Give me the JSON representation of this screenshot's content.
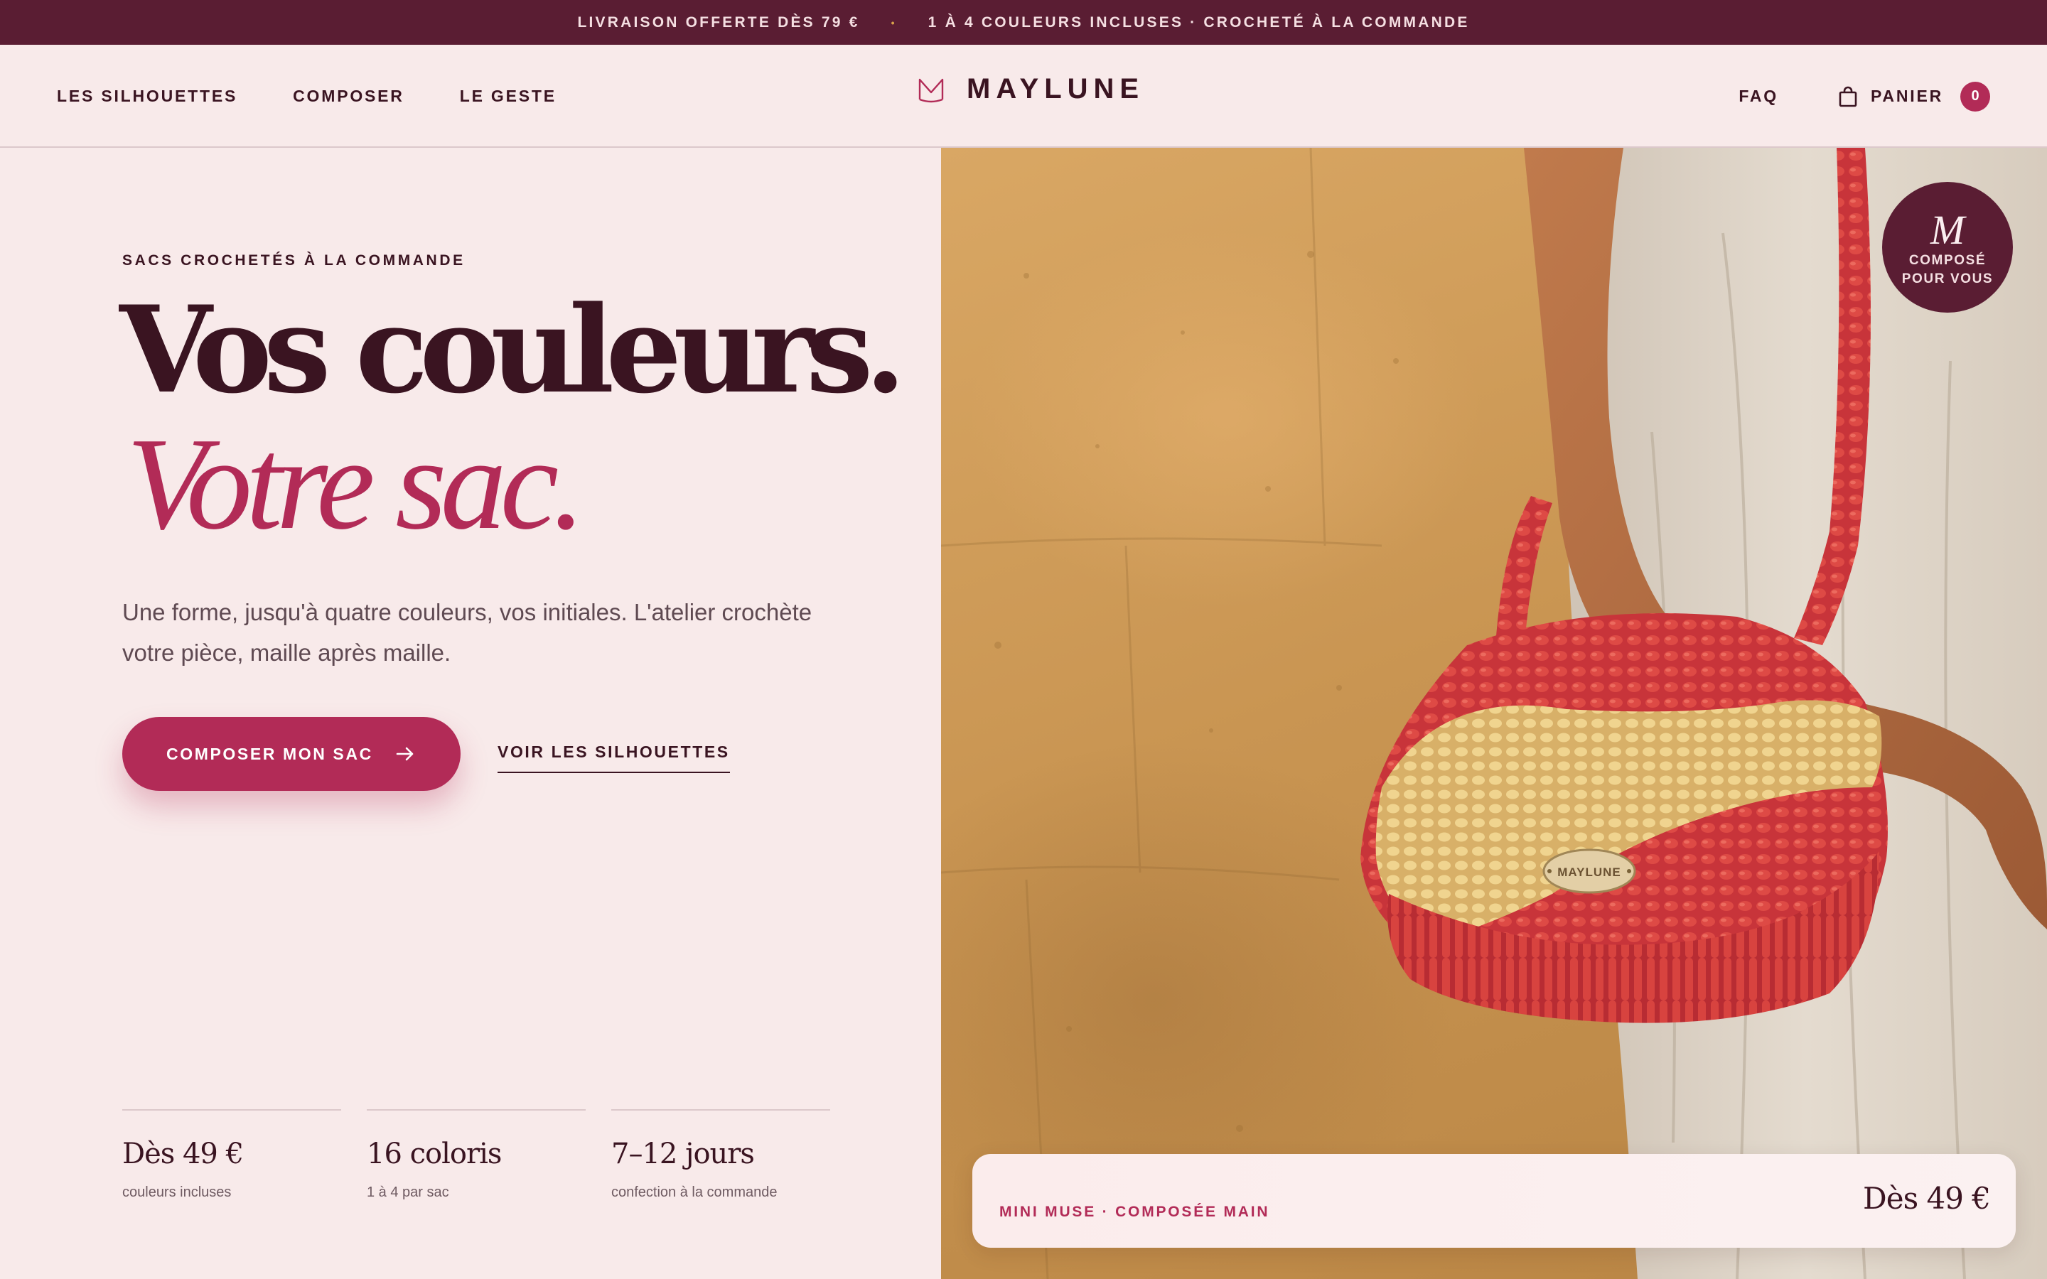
{
  "announcement": {
    "left": "LIVRAISON OFFERTE DÈS 79 €",
    "separator": "•",
    "right": "1 À 4 COULEURS INCLUSES · CROCHETÉ À LA COMMANDE"
  },
  "header": {
    "nav": [
      "LES SILHOUETTES",
      "COMPOSER",
      "LE GESTE"
    ],
    "brand": "MAYLUNE",
    "faq": "FAQ",
    "cart_label": "PANIER",
    "cart_count": "0"
  },
  "hero": {
    "eyebrow": "SACS CROCHETÉS À LA COMMANDE",
    "title_line1": "Vos couleurs.",
    "title_line2": "Votre sac.",
    "lede": "Une forme, jusqu'à quatre couleurs, vos initiales. L'atelier crochète votre pièce, maille après maille.",
    "cta_primary": "COMPOSER MON SAC",
    "cta_secondary": "VOIR LES SILHOUETTES",
    "stats": [
      {
        "value": "Dès 49 €",
        "label": "couleurs incluses"
      },
      {
        "value": "16 coloris",
        "label": "1 à 4 par sac"
      },
      {
        "value": "7–12 jours",
        "label": "confection à la commande"
      }
    ]
  },
  "image": {
    "stamp_letter": "M",
    "stamp_text_1": "COMPOSÉ",
    "stamp_text_2": "POUR VOUS",
    "bag_tag": "MAYLUNE",
    "card_name": "MINI MUSE · COMPOSÉE MAIN",
    "card_price": "Dès 49 €"
  },
  "colors": {
    "announce_bg": "#5a1d33",
    "page_bg": "#f8eaea",
    "accent": "#b22b57",
    "ink": "#3a1421",
    "bag_red": "#cf3a3a",
    "bag_stripe": "#e8c57e"
  }
}
